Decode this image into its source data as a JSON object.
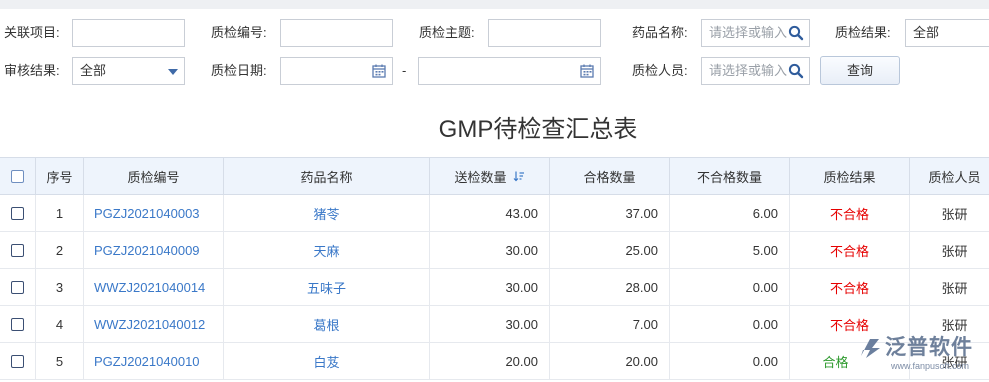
{
  "filters": {
    "row1": [
      {
        "label": "关联项目:",
        "value": "",
        "placeholder": ""
      },
      {
        "label": "质检编号:",
        "value": "",
        "placeholder": ""
      },
      {
        "label": "质检主题:",
        "value": "",
        "placeholder": ""
      },
      {
        "label": "药品名称:",
        "value": "",
        "placeholder": "请选择或输入"
      },
      {
        "label": "质检结果:",
        "value": "全部",
        "placeholder": ""
      }
    ],
    "row2": [
      {
        "label": "审核结果:",
        "value": "全部",
        "placeholder": ""
      },
      {
        "label": "质检日期:",
        "value": "",
        "placeholder": ""
      },
      {
        "label": "质检人员:",
        "value": "",
        "placeholder": "请选择或输入"
      }
    ],
    "date_separator": "-",
    "query_button": "查询"
  },
  "report_title": "GMP待检查汇总表",
  "table": {
    "headers": [
      "序号",
      "质检编号",
      "药品名称",
      "送检数量",
      "合格数量",
      "不合格数量",
      "质检结果",
      "质检人员"
    ],
    "rows": [
      {
        "no": "1",
        "code": "PGZJ2021040003",
        "drug": "猪苓",
        "sent": "43.00",
        "pass": "37.00",
        "fail": "6.00",
        "result": "不合格",
        "result_status": "fail",
        "inspector": "张研"
      },
      {
        "no": "2",
        "code": "PGZJ2021040009",
        "drug": "天麻",
        "sent": "30.00",
        "pass": "25.00",
        "fail": "5.00",
        "result": "不合格",
        "result_status": "fail",
        "inspector": "张研"
      },
      {
        "no": "3",
        "code": "WWZJ2021040014",
        "drug": "五味子",
        "sent": "30.00",
        "pass": "28.00",
        "fail": "0.00",
        "result": "不合格",
        "result_status": "fail",
        "inspector": "张研"
      },
      {
        "no": "4",
        "code": "WWZJ2021040012",
        "drug": "葛根",
        "sent": "30.00",
        "pass": "7.00",
        "fail": "0.00",
        "result": "不合格",
        "result_status": "fail",
        "inspector": "张研"
      },
      {
        "no": "5",
        "code": "PGZJ2021040010",
        "drug": "白芨",
        "sent": "20.00",
        "pass": "20.00",
        "fail": "0.00",
        "result": "合格",
        "result_status": "pass",
        "inspector": "张研"
      }
    ]
  },
  "colors": {
    "fail": "#e60000",
    "pass": "#2e9a2e",
    "link": "#3a78c8",
    "header_bg": "#eef4fc"
  },
  "watermark": {
    "text": "泛普软件",
    "url": "www.fanpusoft.com"
  }
}
